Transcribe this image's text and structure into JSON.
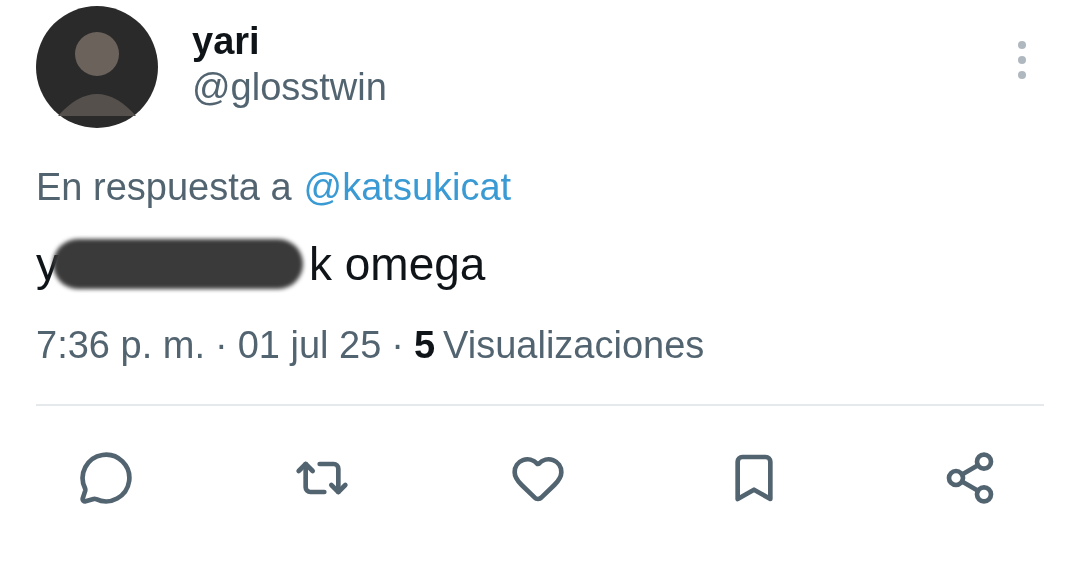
{
  "author": {
    "name": "yari",
    "handle": "@glosstwin"
  },
  "reply_to": {
    "label": "En respuesta a",
    "handle": "@katsukicat"
  },
  "tweet": {
    "text_start": "y",
    "redacted": true,
    "text_end": "k omega"
  },
  "meta": {
    "time": "7:36 p. m.",
    "separator_1": "·",
    "date": "01 jul 25",
    "separator_2": "·",
    "views_count": "5",
    "views_label": "Visualizaciones"
  }
}
